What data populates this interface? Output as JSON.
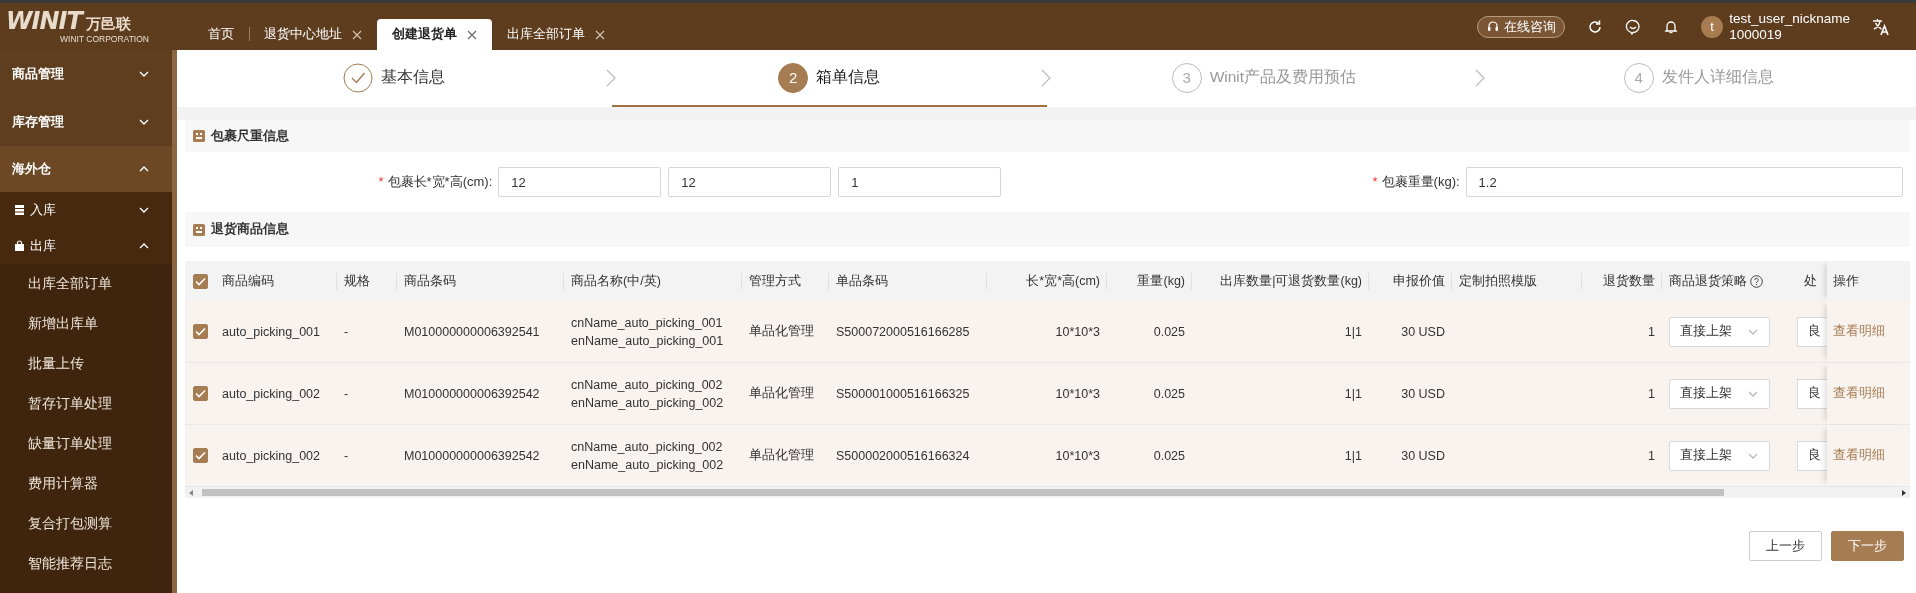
{
  "header": {
    "logo": {
      "wordmark": "WINIT",
      "chinese": "万邑联",
      "subtitle": "WINIT CORPORATION"
    },
    "tabs": [
      {
        "label": "首页",
        "closable": false,
        "selected": false
      },
      {
        "label": "退货中心地址",
        "closable": true,
        "selected": false
      },
      {
        "label": "创建退货单",
        "closable": true,
        "selected": true
      },
      {
        "label": "出库全部订单",
        "closable": true,
        "selected": false
      }
    ],
    "consult_button": "在线咨询",
    "user": {
      "avatar": "t",
      "name": "test_user_nickname",
      "id": "1000019"
    }
  },
  "sidebar": {
    "items": [
      {
        "label": "商品管理",
        "expanded": false
      },
      {
        "label": "库存管理",
        "expanded": false
      },
      {
        "label": "海外仓",
        "expanded": true,
        "children": [
          {
            "label": "入库",
            "expanded": false
          },
          {
            "label": "出库",
            "expanded": true,
            "children": [
              {
                "label": "出库全部订单"
              },
              {
                "label": "新增出库单"
              },
              {
                "label": "批量上传"
              },
              {
                "label": "暂存订单处理"
              },
              {
                "label": "缺量订单处理"
              },
              {
                "label": "费用计算器"
              },
              {
                "label": "复合打包测算"
              },
              {
                "label": "智能推荐日志"
              }
            ]
          }
        ]
      }
    ]
  },
  "steps": [
    {
      "label": "基本信息",
      "done": true,
      "selected": false
    },
    {
      "number": "2",
      "label": "箱单信息",
      "done": false,
      "selected": true
    },
    {
      "number": "3",
      "label": "Winit产品及费用预估",
      "done": false,
      "selected": false
    },
    {
      "number": "4",
      "label": "发件人详细信息",
      "done": false,
      "selected": false
    }
  ],
  "package_section": {
    "title": "包裹尺重信息",
    "fields": [
      {
        "required_mark": "*",
        "label": "包裹长*宽*高(cm):",
        "values": [
          "12",
          "12",
          "1"
        ]
      },
      {
        "required_mark": "*",
        "label": "包裹重量(kg):",
        "values": [
          "1.2"
        ]
      }
    ]
  },
  "goods_section": {
    "title": "退货商品信息",
    "all_checked": true,
    "columns": [
      {
        "label": "商品编码"
      },
      {
        "label": "规格"
      },
      {
        "label": "商品条码"
      },
      {
        "label": "商品名称(中/英)"
      },
      {
        "label": "管理方式"
      },
      {
        "label": "单品条码"
      },
      {
        "label": "长*宽*高(cm)",
        "right_aligned": true
      },
      {
        "label": "重量(kg)",
        "right_aligned": true
      },
      {
        "label": "出库数量|可退货数量(kg)",
        "right_aligned": true
      },
      {
        "label": "申报价值",
        "right_aligned": true
      },
      {
        "label": "定制拍照模版"
      },
      {
        "label": "退货数量",
        "right_aligned": true
      },
      {
        "label": "商品退货策略",
        "help": true
      },
      {
        "label": "处"
      },
      {
        "label": "操作"
      }
    ],
    "rows": [
      {
        "checked": true,
        "code": "auto_picking_001",
        "spec": "-",
        "barcode": "M010000000006392541",
        "name_cn": "cnName_auto_picking_001",
        "name_en": "enName_auto_picking_001",
        "management": "单品化管理",
        "item_barcode": "S500072000516166285",
        "dimensions": "10*10*3",
        "weight": "0.025",
        "quantity": "1|1",
        "declared_value": "30 USD",
        "return_qty": "1",
        "strategy": "直接上架",
        "handling": "良",
        "action": "查看明细"
      },
      {
        "checked": true,
        "code": "auto_picking_002",
        "spec": "-",
        "barcode": "M010000000006392542",
        "name_cn": "cnName_auto_picking_002",
        "name_en": "enName_auto_picking_002",
        "management": "单品化管理",
        "item_barcode": "S500001000516166325",
        "dimensions": "10*10*3",
        "weight": "0.025",
        "quantity": "1|1",
        "declared_value": "30 USD",
        "return_qty": "1",
        "strategy": "直接上架",
        "handling": "良",
        "action": "查看明细"
      },
      {
        "checked": true,
        "code": "auto_picking_002",
        "spec": "-",
        "barcode": "M010000000006392542",
        "name_cn": "cnName_auto_picking_002",
        "name_en": "enName_auto_picking_002",
        "management": "单品化管理",
        "item_barcode": "S500002000516166324",
        "dimensions": "10*10*3",
        "weight": "0.025",
        "quantity": "1|1",
        "declared_value": "30 USD",
        "return_qty": "1",
        "strategy": "直接上架",
        "handling": "良",
        "action": "查看明细"
      }
    ]
  },
  "buttons": [
    {
      "label": "上一步",
      "kind": "secondary"
    },
    {
      "label": "下一步",
      "kind": "primary"
    }
  ]
}
